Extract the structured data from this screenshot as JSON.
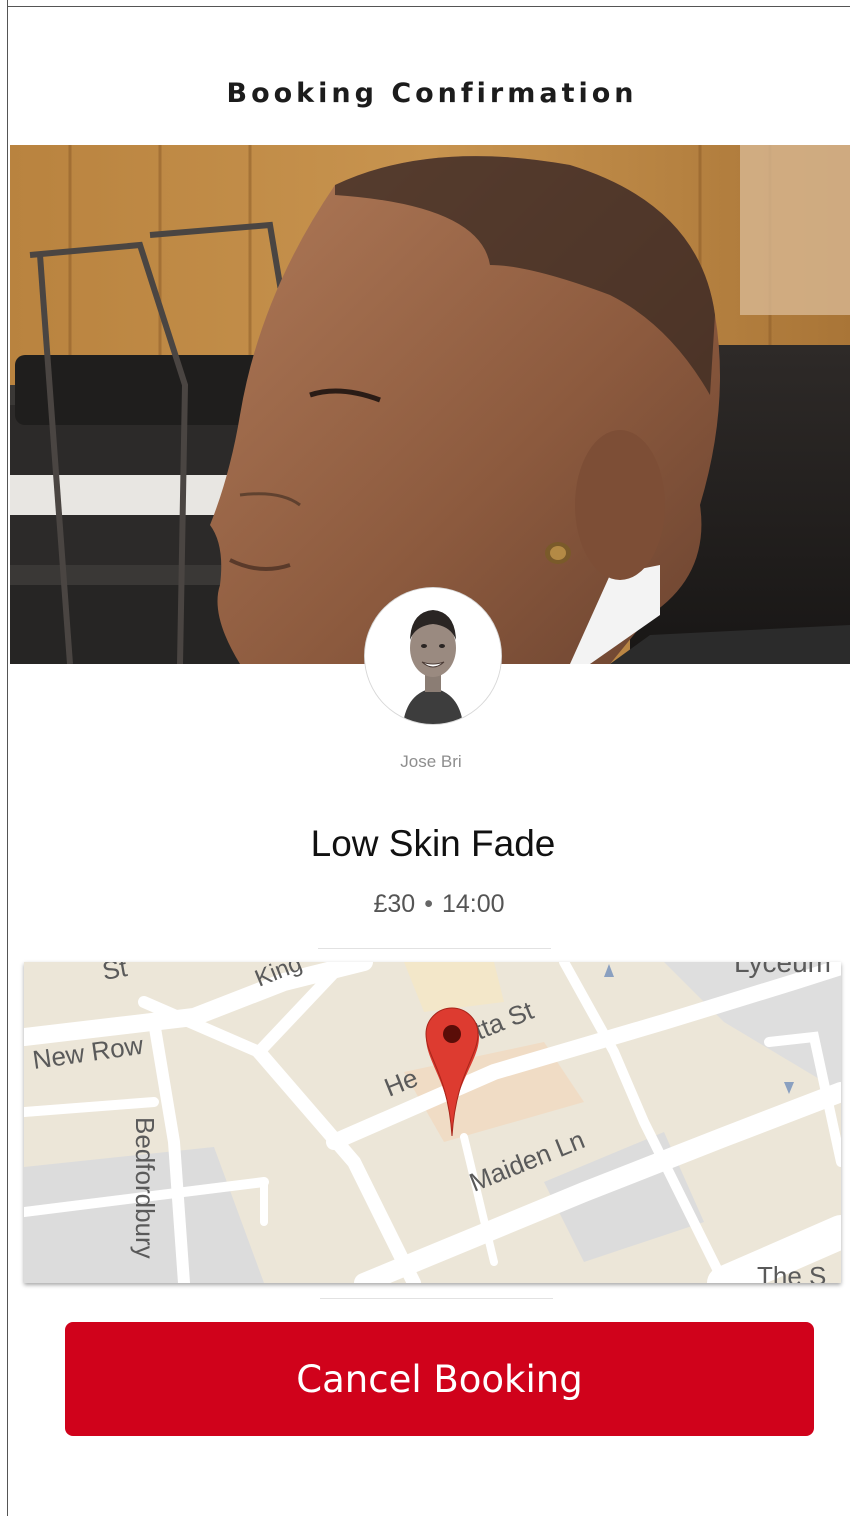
{
  "header": {
    "title": "Booking Confirmation"
  },
  "barber": {
    "name": "Jose Bri"
  },
  "service": {
    "name": "Low Skin Fade",
    "price": "£30",
    "separator": "•",
    "time": "14:00"
  },
  "map": {
    "pin_color": "#d83a2f",
    "streets": {
      "top_left": "St",
      "king": "King",
      "henrietta_part1": "He",
      "henrietta_part2": "tta St",
      "new_row": "New Row",
      "maiden_lane": "Maiden Ln",
      "bedfordbury": "Bedfordbury",
      "lyceum": "Lyceum",
      "the_s": "The S"
    }
  },
  "actions": {
    "cancel_label": "Cancel Booking",
    "cancel_color": "#d0021b"
  }
}
